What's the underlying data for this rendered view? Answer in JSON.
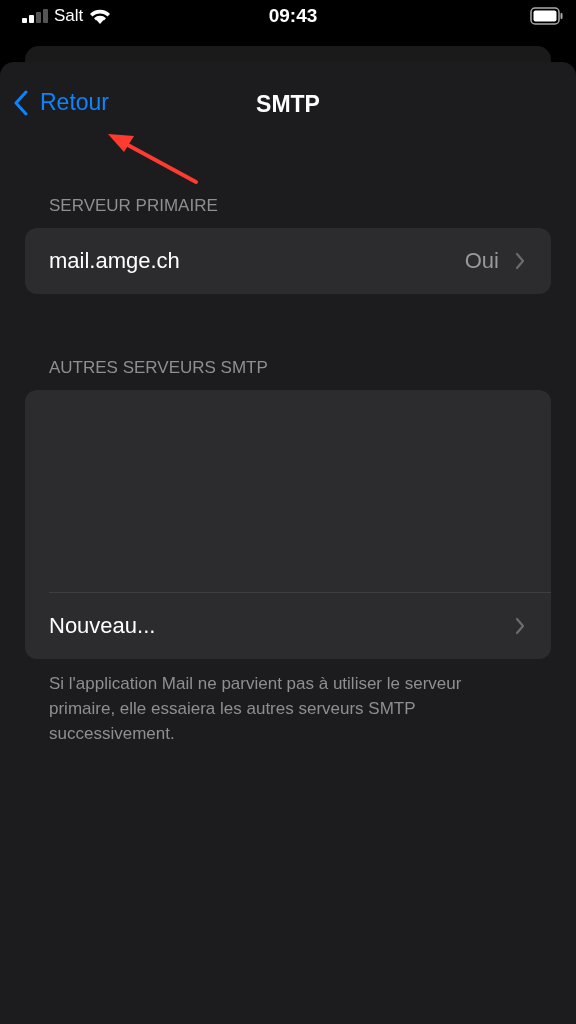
{
  "status_bar": {
    "carrier": "Salt",
    "time": "09:43"
  },
  "nav": {
    "back": "Retour",
    "title": "SMTP"
  },
  "sections": [
    {
      "header": "SERVEUR PRIMAIRE",
      "rows": [
        {
          "label": "mail.amge.ch",
          "value": "Oui"
        }
      ]
    },
    {
      "header": "AUTRES SERVEURS SMTP",
      "rows": [
        {
          "label": "Nouveau..."
        }
      ],
      "footer": "Si l'application Mail ne parvient pas à utiliser le serveur primaire, elle essaiera les autres serveurs SMTP successivement."
    }
  ]
}
